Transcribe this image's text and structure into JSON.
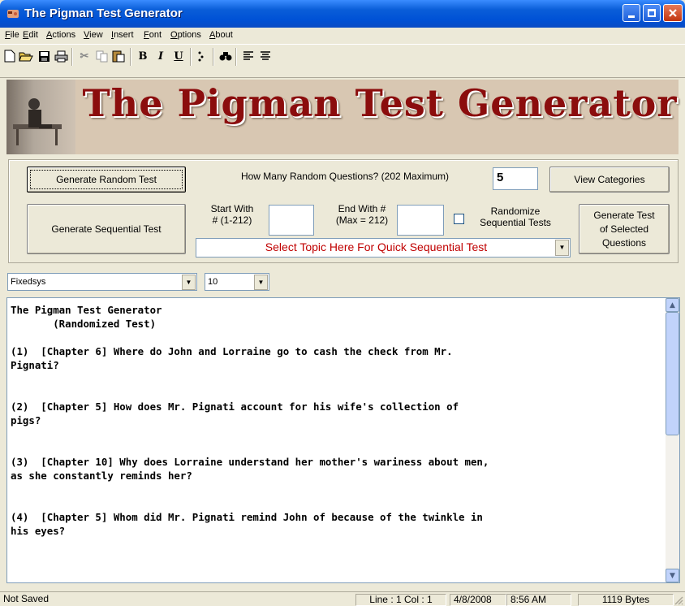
{
  "window": {
    "title": "The Pigman Test Generator"
  },
  "menu": [
    {
      "label": "File",
      "key": "F",
      "rest": "ile"
    },
    {
      "label": "Edit",
      "key": "E",
      "rest": "dit"
    },
    {
      "label": "Actions",
      "key": "A",
      "rest": "ctions"
    },
    {
      "label": "View",
      "key": "V",
      "rest": "iew"
    },
    {
      "label": "Insert",
      "key": "I",
      "rest": "nsert"
    },
    {
      "label": "Font",
      "key": "F",
      "rest": "ont"
    },
    {
      "label": "Options",
      "key": "O",
      "rest": "ptions"
    },
    {
      "label": "About",
      "key": "A",
      "rest": "bout"
    }
  ],
  "toolbar": {
    "bold": "B",
    "italic": "I",
    "underline": "U"
  },
  "banner": {
    "title": "The Pigman Test Generator"
  },
  "controls": {
    "random_button": "Generate Random Test",
    "how_many_label": "How Many Random Questions? (202 Maximum)",
    "how_many_value": "5",
    "view_categories": "View Categories",
    "sequential_button": "Generate Sequential Test",
    "start_with_l1": "Start With",
    "start_with_l2": "# (1-212)",
    "start_value": "",
    "end_with_l1": "End With #",
    "end_with_l2": "(Max = 212)",
    "end_value": "",
    "randomize_l1": "Randomize",
    "randomize_l2": "Sequential Tests",
    "randomize_checked": false,
    "selected_l1": "Generate Test",
    "selected_l2": "of Selected",
    "selected_l3": "Questions",
    "topic_select": "Select Topic Here For Quick Sequential Test",
    "topic_color": "#c00000"
  },
  "font_bar": {
    "font": "Fixedsys",
    "size": "10"
  },
  "editor": {
    "text": "The Pigman Test Generator\n       (Randomized Test)\n\n(1)  [Chapter 6] Where do John and Lorraine go to cash the check from Mr.\nPignati?\n\n\n(2)  [Chapter 5] How does Mr. Pignati account for his wife's collection of\npigs?\n\n\n(3)  [Chapter 10] Why does Lorraine understand her mother's wariness about men,\nas she constantly reminds her?\n\n\n(4)  [Chapter 5] Whom did Mr. Pignati remind John of because of the twinkle in\nhis eyes?"
  },
  "status": {
    "saved": "Not Saved",
    "position": "Line : 1   Col : 1",
    "date": "4/8/2008",
    "time": "8:56 AM",
    "size": "1119 Bytes"
  }
}
